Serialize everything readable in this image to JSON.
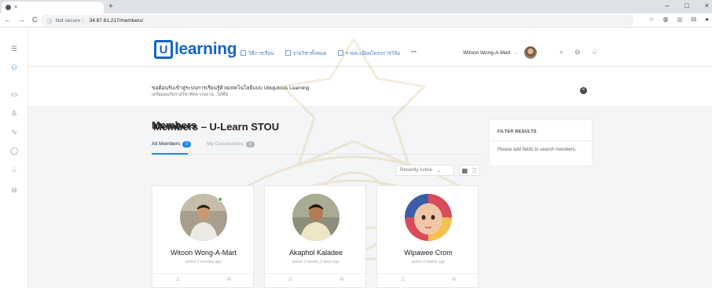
{
  "browser": {
    "tab_title": "Members – U-Learn STOU",
    "tab_close": "×",
    "new_tab": "+",
    "window_controls": [
      "–",
      "□",
      "×"
    ],
    "nav": {
      "back": "←",
      "forward": "→",
      "reload": "C"
    },
    "security_label": "Not secure",
    "url": "34.87.61.217/members/"
  },
  "header": {
    "logo_u": "U",
    "logo_word": "learning",
    "menu": [
      "วิธีการเรียน",
      "รายวิชาทั้งหมด",
      "รายละเอียดโครงการวิจัย",
      "•••"
    ],
    "user_name": "Witoon Wong-A-Mart",
    "user_caret": "⌄"
  },
  "banner": {
    "line1": "ขอต้อนรับเข้าสู่ระบบการเรียนรู้ด้วยเทคโนโลยีแบบ Ubiquitous Learning",
    "line2": "เตรียมพบกับรายวิชาที่หลากหลาย...ได้ที่นี่",
    "close": "×"
  },
  "members": {
    "title": "Members",
    "tabs": [
      {
        "label": "All Members",
        "count": "3"
      },
      {
        "label": "My Connections",
        "count": "0"
      }
    ],
    "sort_label": "Recently Active",
    "sort_caret": "⌄"
  },
  "filter": {
    "heading": "FILTER RESULTS",
    "body": "Please add fields to search members."
  },
  "cards": [
    {
      "name": "Witoon Wong-A-Mart",
      "active": "active 3 minutes ago",
      "online": true
    },
    {
      "name": "Akaphol Kaladee",
      "active": "active 3 weeks, 2 days ago",
      "online": false
    },
    {
      "name": "Wipawee Crom",
      "active": "active 4 weeks ago",
      "online": false
    }
  ],
  "icons": {
    "rail": [
      "menu-icon",
      "users-icon",
      "courses-icon",
      "profile-icon",
      "activity-icon",
      "messages-icon",
      "notifications-icon",
      "cart-icon"
    ],
    "header": [
      "search-icon",
      "cart-icon",
      "bell-icon"
    ]
  },
  "colors": {
    "brand": "#1565c0",
    "accent": "#1e88e5",
    "online": "#2ecc40"
  }
}
